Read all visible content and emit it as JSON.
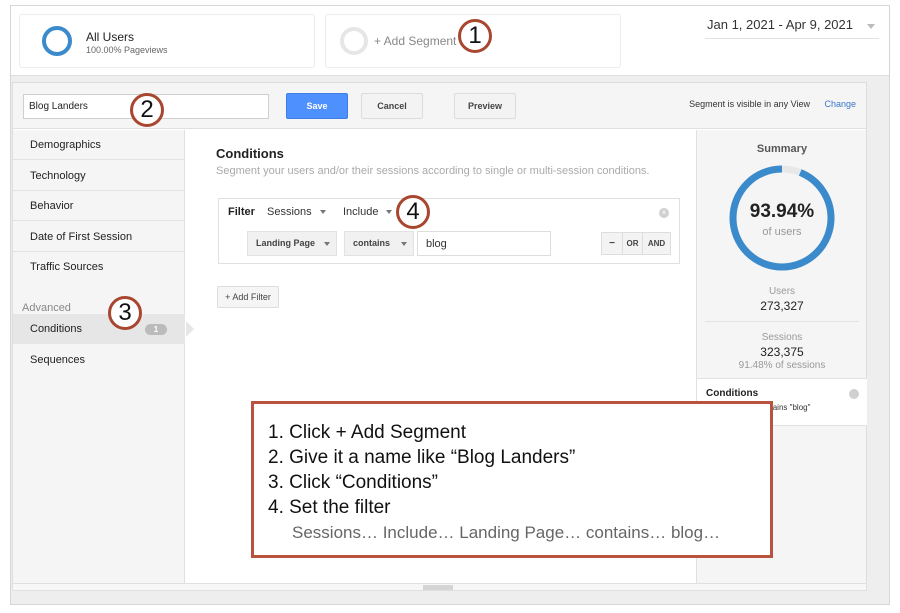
{
  "segments": {
    "all_users": {
      "title": "All Users",
      "subtitle": "100.00% Pageviews",
      "ring_color": "#3b8acb"
    },
    "add_segment": {
      "label": "+ Add Segment"
    }
  },
  "date_range": {
    "value": "Jan 1, 2021 - Apr 9, 2021"
  },
  "editor": {
    "segment_name": "Blog Landers",
    "save_label": "Save",
    "cancel_label": "Cancel",
    "preview_label": "Preview",
    "visibility_text": "Segment is visible in any View",
    "change_label": "Change"
  },
  "nav": {
    "items": [
      {
        "label": "Demographics"
      },
      {
        "label": "Technology"
      },
      {
        "label": "Behavior"
      },
      {
        "label": "Date of First Session"
      },
      {
        "label": "Traffic Sources"
      }
    ],
    "advanced_heading": "Advanced",
    "advanced_items": [
      {
        "label": "Conditions",
        "badge": "1",
        "active": true
      },
      {
        "label": "Sequences"
      }
    ]
  },
  "conditions": {
    "title": "Conditions",
    "description": "Segment your users and/or their sessions according to single or multi-session conditions.",
    "filter": {
      "label": "Filter",
      "scope": "Sessions",
      "mode": "Include",
      "dimension": "Landing Page",
      "operator": "contains",
      "value": "blog",
      "ops": {
        "minus": "−",
        "or": "OR",
        "and": "AND"
      }
    },
    "add_filter_label": "+ Add Filter"
  },
  "summary": {
    "title": "Summary",
    "percent_value": 93.94,
    "percent_label": "93.94%",
    "percent_sub": "of users",
    "users_label": "Users",
    "users_value": "273,327",
    "sessions_label": "Sessions",
    "sessions_value": "323,375",
    "sessions_sub": "91.48% of sessions",
    "condition_title": "Conditions",
    "condition_text": "Landing Page contains \"blog\"",
    "accent_color": "#3b8acb",
    "track_color": "#e8e8e8"
  },
  "markers": [
    "1",
    "2",
    "3",
    "4"
  ],
  "callout": {
    "lines": [
      "1. Click + Add Segment",
      "2. Give it a name like “Blog Landers”",
      "3. Click “Conditions”",
      "4. Set the filter"
    ],
    "sub": "Sessions… Include… Landing Page… contains… blog…",
    "border_color": "#b9533f"
  }
}
